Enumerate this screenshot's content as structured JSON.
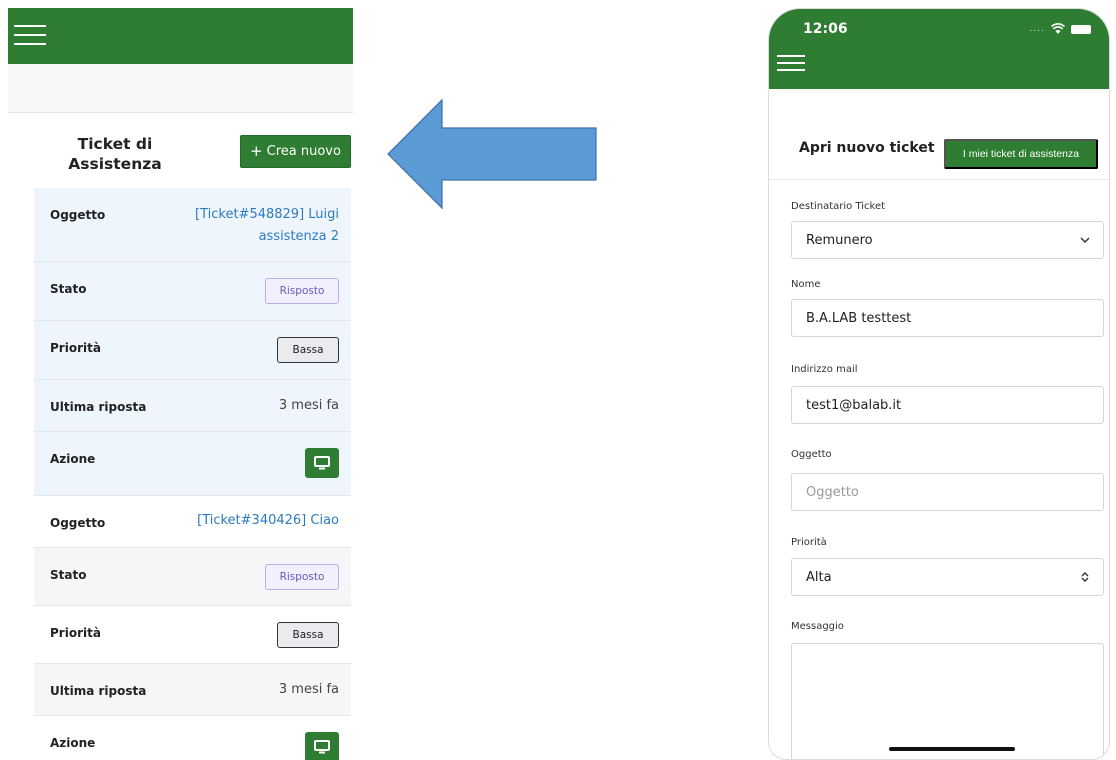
{
  "left": {
    "title_line1": "Ticket di",
    "title_line2": "Assistenza",
    "create_button": "Crea nuovo",
    "create_icon": "+",
    "tickets": [
      {
        "oggetto_label": "Oggetto",
        "oggetto_line1": "[Ticket#548829] Luigi",
        "oggetto_line2": "assistenza 2",
        "stato_label": "Stato",
        "stato_value": "Risposto",
        "priorita_label": "Priorità",
        "priorita_value": "Bassa",
        "ultima_label": "Ultima riposta",
        "ultima_value": "3 mesi fa",
        "azione_label": "Azione"
      },
      {
        "oggetto_label": "Oggetto",
        "oggetto_line1": "[Ticket#340426] Ciao",
        "oggetto_line2": "",
        "stato_label": "Stato",
        "stato_value": "Risposto",
        "priorita_label": "Priorità",
        "priorita_value": "Bassa",
        "ultima_label": "Ultima riposta",
        "ultima_value": "3 mesi fa",
        "azione_label": "Azione"
      }
    ]
  },
  "arrow": {
    "color": "#5b9bd5",
    "stroke": "#3d6fa8",
    "icon": "arrow-left-icon"
  },
  "right": {
    "clock": "12:06",
    "signal": "....",
    "form_title": "Apri nuovo ticket",
    "my_tickets_button": "I miei ticket di assistenza",
    "fields": {
      "destinatario_label": "Destinatario Ticket",
      "destinatario_value": "Remunero",
      "nome_label": "Nome",
      "nome_value": "B.A.LAB testtest",
      "email_label": "Indirizzo mail",
      "email_value": "test1@balab.it",
      "oggetto_label": "Oggetto",
      "oggetto_placeholder": "Oggetto",
      "priorita_label": "Priorità",
      "priorita_value": "Alta",
      "messaggio_label": "Messaggio"
    }
  },
  "colors": {
    "brand_green": "#2e7d32",
    "link_blue": "#2f7bbf",
    "status_purple": "#6b5bb8"
  }
}
